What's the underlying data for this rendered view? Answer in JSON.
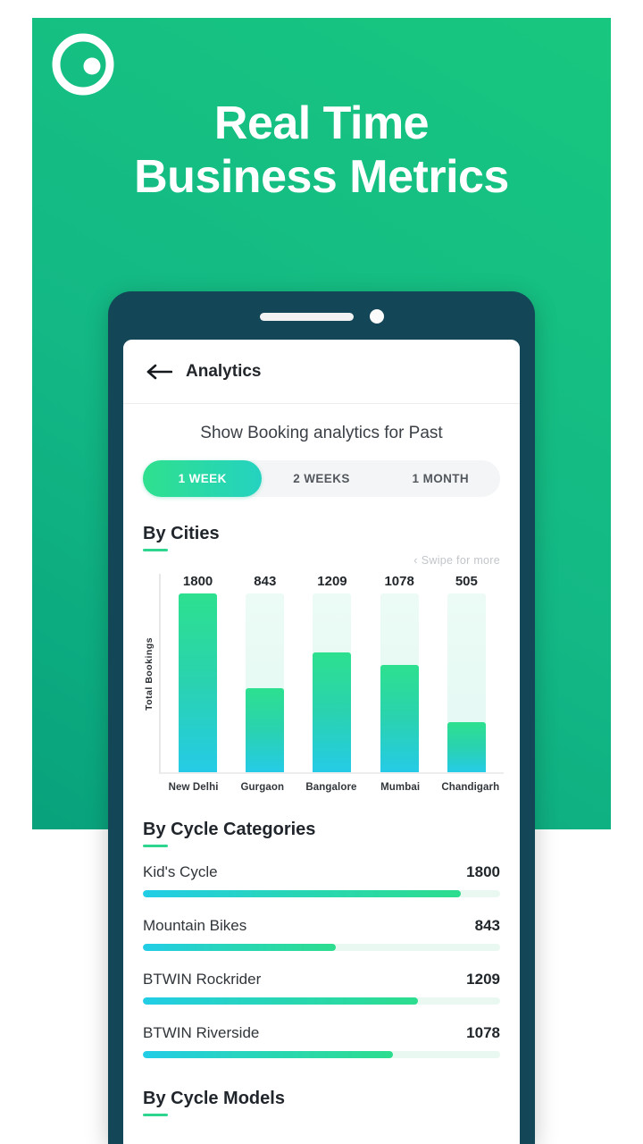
{
  "promo": {
    "logo_icon": "circle-dot-logo-icon",
    "headline_line1": "Real Time",
    "headline_line2": "Business Metrics",
    "bg_color_top": "#18C77F",
    "bg_color_bottom": "#08A27C"
  },
  "phone": {
    "bezel_color": "#134657",
    "speaker_icon": "speaker-grill-icon",
    "camera_icon": "front-camera-icon"
  },
  "app": {
    "back_icon": "back-arrow-icon",
    "title": "Analytics"
  },
  "filter": {
    "prompt": "Show Booking analytics for Past",
    "options": [
      {
        "label": "1 WEEK",
        "active": true
      },
      {
        "label": "2 WEEKS",
        "active": false
      },
      {
        "label": "1 MONTH",
        "active": false
      }
    ],
    "active_color": "#2EE08E"
  },
  "cities_section": {
    "title": "By Cities",
    "swipe_hint": "Swipe for more",
    "swipe_chevron_icon": "chevron-left-icon"
  },
  "chart_data": {
    "type": "bar",
    "title": "By Cities",
    "xlabel": "",
    "ylabel": "Total Bookings",
    "categories": [
      "New Delhi",
      "Gurgaon",
      "Bangalore",
      "Mumbai",
      "Chandigarh"
    ],
    "values": [
      1800,
      843,
      1209,
      1078,
      505
    ],
    "ylim": [
      0,
      1800
    ],
    "grid": false,
    "legend": "none",
    "bar_gradient_top": "#2DE08F",
    "bar_gradient_bottom": "#25CBE6",
    "track_color": "#EAF9F3"
  },
  "categories_section": {
    "title": "By Cycle Categories",
    "max_value": 2020,
    "rows": [
      {
        "name": "Kid's Cycle",
        "value": 1800,
        "pct": 89
      },
      {
        "name": "Mountain Bikes",
        "value": 843,
        "pct": 54
      },
      {
        "name": "BTWIN Rockrider",
        "value": 1209,
        "pct": 77
      },
      {
        "name": "BTWIN Riverside",
        "value": 1078,
        "pct": 70
      }
    ]
  },
  "models_section": {
    "title": "By Cycle Models"
  }
}
